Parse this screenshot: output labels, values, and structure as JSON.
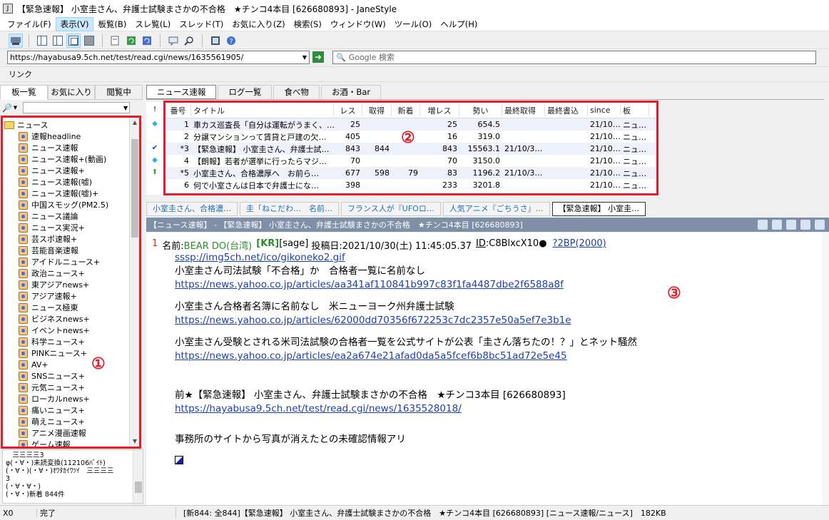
{
  "window": {
    "title": "【緊急速報】 小室圭さん、弁護士試験まさかの不合格　★チンコ4本目 [626680893] - JaneStyle"
  },
  "menu": [
    "ファイル(F)",
    "表示(V)",
    "板覧(B)",
    "スレ覧(L)",
    "スレッド(T)",
    "お気に入り(Z)",
    "検索(S)",
    "ウィンドウ(W)",
    "ツール(O)",
    "ヘルプ(H)"
  ],
  "address": {
    "url": "https://hayabusa9.5ch.net/test/read.cgi/news/1635561905/",
    "search_placeholder": "Google 検索"
  },
  "linkbar": {
    "label": "リンク"
  },
  "left_tabs": [
    "板一覧",
    "お気に入り",
    "閲覧中"
  ],
  "tree": {
    "root": "ニュース",
    "items": [
      "速報headline",
      "ニュース速報",
      "ニュース速報+(動画)",
      "ニュース速報+",
      "ニュース速報(嘘)",
      "ニュース速報(嘘)+",
      "中国スモッグ(PM2.5)",
      "ニュース議論",
      "ニュース実況+",
      "芸スポ速報+",
      "芸能音楽速報",
      "アイドルニュース+",
      "政治ニュース+",
      "東アジアnews+",
      "アジア速報+",
      "ニュース極東",
      "ビジネスnews+",
      "イベントnews+",
      "科学ニュース+",
      "PINKニュース+",
      "AV+",
      "SNSニュース+",
      "元気ニュース+",
      "ローカルnews+",
      "痛いニュース+",
      "萌えニュース+",
      "アニメ漫画速報",
      "ゲーム速報"
    ]
  },
  "markers": {
    "one": "①",
    "two": "②",
    "three": "③"
  },
  "log": [
    "　三三三三3",
    "φ(・∀・)未読変換(112106ﾊﾞｲﾄ)",
    "(・∀・)(・∀・)ｵﾜﾀｶｲﾜﾂｲ　三三三三",
    "3",
    "(・∀・∀・)",
    "(・∀・)新着 844件"
  ],
  "board_tabs": [
    "ニュース速報",
    "ログ一覧",
    "食べ物",
    "お酒・Bar"
  ],
  "thread_list": {
    "flag_header": "!",
    "headers": {
      "no": "番号",
      "title": "タイトル",
      "res": "レス",
      "get": "取得",
      "new": "新着",
      "inc": "増レス",
      "mom": "勢い",
      "lastget": "最終取得",
      "lastpost": "最終書込",
      "since": "since",
      "board": "板"
    },
    "rows": [
      {
        "flag": "◆",
        "no": "1",
        "title": "車カス巡査長「自分は運転がうまく、…",
        "res": "25",
        "get": "",
        "new": "",
        "inc": "25",
        "mom": "654.5",
        "lastget": "",
        "lastpost": "",
        "since": "21/10…",
        "board": "ニュ…"
      },
      {
        "flag": "",
        "no": "2",
        "title": "分譲マンションって賃貸と戸建の欠…",
        "res": "405",
        "get": "",
        "new": "",
        "inc": "16",
        "mom": "319.0",
        "lastget": "",
        "lastpost": "",
        "since": "21/10…",
        "board": "ニュ…"
      },
      {
        "flag": "✔",
        "no": "*3",
        "title": "【緊急速報】 小室圭さん、弁護士試…",
        "res": "843",
        "get": "844",
        "new": "",
        "inc": "843",
        "mom": "15563.1",
        "lastget": "21/10/3…",
        "lastpost": "",
        "since": "21/10…",
        "board": "ニュ…"
      },
      {
        "flag": "◆",
        "no": "4",
        "title": "【朗報】若者が選挙に行ったらマジ…",
        "res": "70",
        "get": "",
        "new": "",
        "inc": "70",
        "mom": "3150.0",
        "lastget": "",
        "lastpost": "",
        "since": "21/10…",
        "board": "ニュ…"
      },
      {
        "flag": "⬆",
        "no": "*5",
        "title": "小室圭さん、合格濃厚へ　お前ら…",
        "res": "677",
        "get": "598",
        "new": "79",
        "inc": "83",
        "mom": "1196.2",
        "lastget": "21/10/3…",
        "lastpost": "",
        "since": "21/10…",
        "board": "ニュ…"
      },
      {
        "flag": "",
        "no": "6",
        "title": "何で小室さんは日本で弁護士にな…",
        "res": "398",
        "get": "",
        "new": "",
        "inc": "233",
        "mom": "3201.8",
        "lastget": "",
        "lastpost": "",
        "since": "21/10…",
        "board": "ニュ…"
      }
    ]
  },
  "thread_tabs": [
    "小室圭さん、合格濃…",
    "圭「ねこだわ…　名前…",
    "フランス人が『UFOロ…",
    "人気アニメ『ごちうさ』…",
    "【緊急速報】 小室圭…"
  ],
  "thread_bar": {
    "title": "【ニュース速報】 - 【緊急速報】 小室圭さん、弁護士試験まさかの不合格　★チンコ4本目 [626680893]"
  },
  "post": {
    "number": "1",
    "name_label": "名前:",
    "name": "BEAR DO(台湾)",
    "kr": "[KR]",
    "mail": "[sage]",
    "date": "投稿日:2021/10/30(土) 11:45:05.37",
    "id_label": "ID",
    "id": ":C8BlxcX10●",
    "be": "?2BP(2000)",
    "icon_url": "sssp://img5ch.net/ico/gikoneko2.gif",
    "lines": [
      {
        "text": "小室圭さん司法試験「不合格」か　合格者一覧に名前なし",
        "link": "https://news.yahoo.co.jp/articles/aa341af110841b997c83f1fa4487dbe2f6588a8f"
      },
      {
        "text": "小室圭さん合格者名簿に名前なし　米ニューヨーク州弁護士試験",
        "link": "https://news.yahoo.co.jp/articles/62000dd70356f672253c7dc2357e50a5ef7e3b1e"
      },
      {
        "text": "小室圭さん受験とされる米司法試験の合格者一覧を公式サイトが公表「圭さん落ちたの！？」とネット騒然",
        "link": "https://news.yahoo.co.jp/articles/ea2a674e21afad0da5a5fcef6b8bc51ad72e5e45"
      }
    ],
    "prev_text": "前★【緊急速報】 小室圭さん、弁護士試験まさかの不合格　★チンコ3本目 [626680893]",
    "prev_link": "https://hayabusa9.5ch.net/test/read.cgi/news/1635528018/",
    "last_line": "事務所のサイトから写真が消えたとの未確認情報アリ"
  },
  "status": {
    "left": "X0",
    "state": "完了",
    "info": "[新844: 全844]【緊急速報】 小室圭さん、弁護士試験まさかの不合格　★チンコ4本目 [626680893] [ニュース速報/ニュース]　182KB"
  },
  "colors": {
    "accent_red": "#e51d2a",
    "link_blue": "#1c3fb4",
    "bar_grey": "#7e8fa7"
  }
}
